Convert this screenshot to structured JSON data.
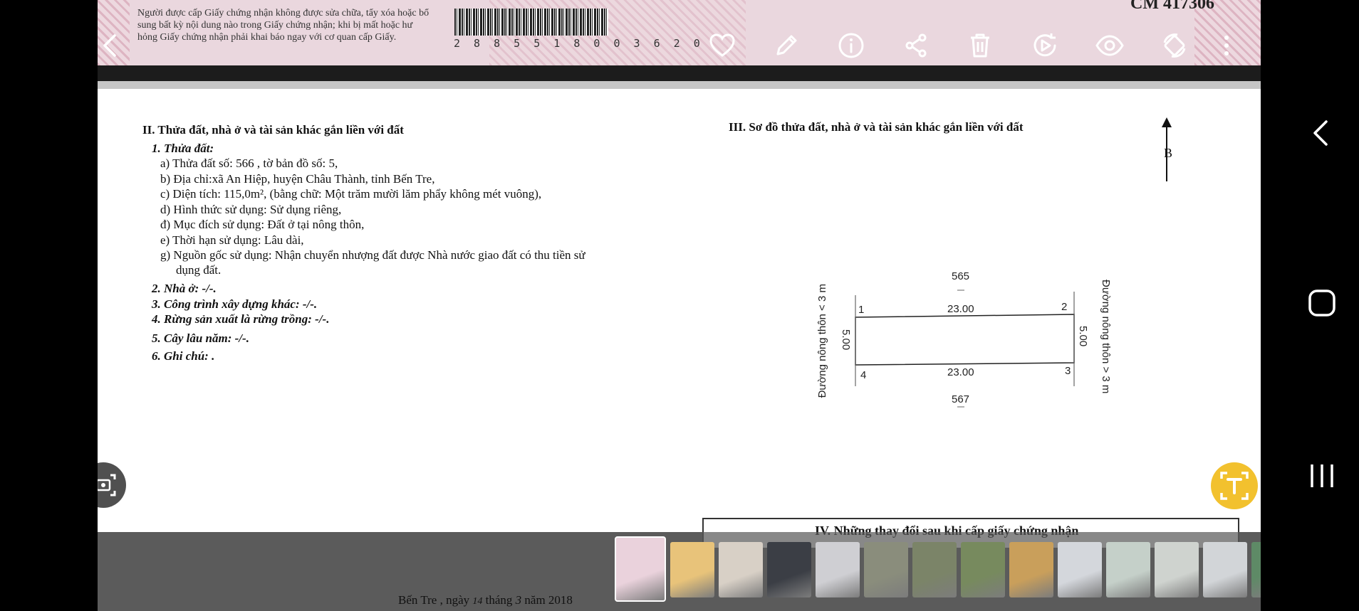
{
  "certificate_top": {
    "notice_lines": [
      "Người được cấp Giấy chứng nhận không được sửa chữa, tẩy xóa hoặc bổ",
      "sung bất kỳ nội dung nào trong Giấy chứng nhận; khi bị mất hoặc hư",
      "hỏng Giấy chứng nhận phải khai báo ngay với cơ quan cấp Giấy."
    ],
    "barcode_number": "2 8 8 5 5 1 8 0 0 3 6 2 0",
    "serial": "CM 417306"
  },
  "toolbar": {
    "items": [
      "heart-icon",
      "pencil-icon",
      "info-icon",
      "share-icon",
      "trash-icon",
      "video-edit-icon",
      "eye-icon",
      "rotate-icon",
      "more-vert-icon"
    ]
  },
  "section2": {
    "title": "II. Thửa đất, nhà ở và tài sản khác gắn liền với đất",
    "land_heading": "1. Thửa đất:",
    "land_lines": [
      "a) Thửa đất số:  566 , tờ bản đồ số: 5,",
      "b) Địa chỉ:xã An Hiệp, huyện Châu Thành, tỉnh Bến Tre,",
      "c) Diện tích: 115,0m², (bằng chữ: Một trăm mười lăm phẩy không mét vuông),",
      "d) Hình thức sử dụng:  Sử dụng riêng,",
      "đ) Mục đích sử dụng: Đất ở tại nông thôn,",
      "e) Thời hạn sử dụng:  Lâu dài,",
      "g) Nguồn gốc sử dụng: Nhận chuyển nhượng đất được Nhà nước giao đất có thu tiền sử",
      "    dụng đất."
    ],
    "items": [
      "2. Nhà ở:  -/-.",
      "3. Công trình xây dựng khác: -/-.",
      "4. Rừng sản xuất là rừng trồng: -/-.",
      "5. Cây lâu năm:  -/-.",
      "6. Ghi chú: ."
    ]
  },
  "section3": {
    "title": "III. Sơ đồ thửa đất, nhà ở và tài sản khác gắn liền với đất",
    "north": "B",
    "neighbor_top": "565",
    "neighbor_bottom": "567",
    "corner_1": "1",
    "corner_2": "2",
    "corner_3": "3",
    "corner_4": "4",
    "len_top": "23.00",
    "len_bottom": "23.00",
    "len_left": "5.00",
    "len_right": "5.00",
    "road_left": "Đường nông thôn < 3 m",
    "road_right": "Đường nông thôn > 3 m"
  },
  "section4": {
    "title": "IV. Những thay đổi sau khi cấp giấy chứng nhận",
    "date_prefix": "Bến Tre , ngày",
    "day": "14",
    "month_label": "tháng",
    "month": "3",
    "year_label": "năm 2018"
  },
  "thumbnails": [
    {
      "name": "certificate",
      "color": "#ead2dc"
    },
    {
      "name": "drawing",
      "color": "#e8c37a"
    },
    {
      "name": "fabric",
      "color": "#d8d0c6"
    },
    {
      "name": "pattern",
      "color": "#3b3e45"
    },
    {
      "name": "document",
      "color": "#cfcfd3"
    },
    {
      "name": "road-1",
      "color": "#8a8d7c"
    },
    {
      "name": "road-2",
      "color": "#7b8468"
    },
    {
      "name": "road-3",
      "color": "#778a5e"
    },
    {
      "name": "food",
      "color": "#c99f5b"
    },
    {
      "name": "doc-2",
      "color": "#d4d7dc"
    },
    {
      "name": "doc-3",
      "color": "#c5d0c9"
    },
    {
      "name": "doc-4",
      "color": "#cfd3cf"
    },
    {
      "name": "doc-5",
      "color": "#d2d5d8"
    },
    {
      "name": "landscape",
      "color": "#5e8a66"
    }
  ]
}
